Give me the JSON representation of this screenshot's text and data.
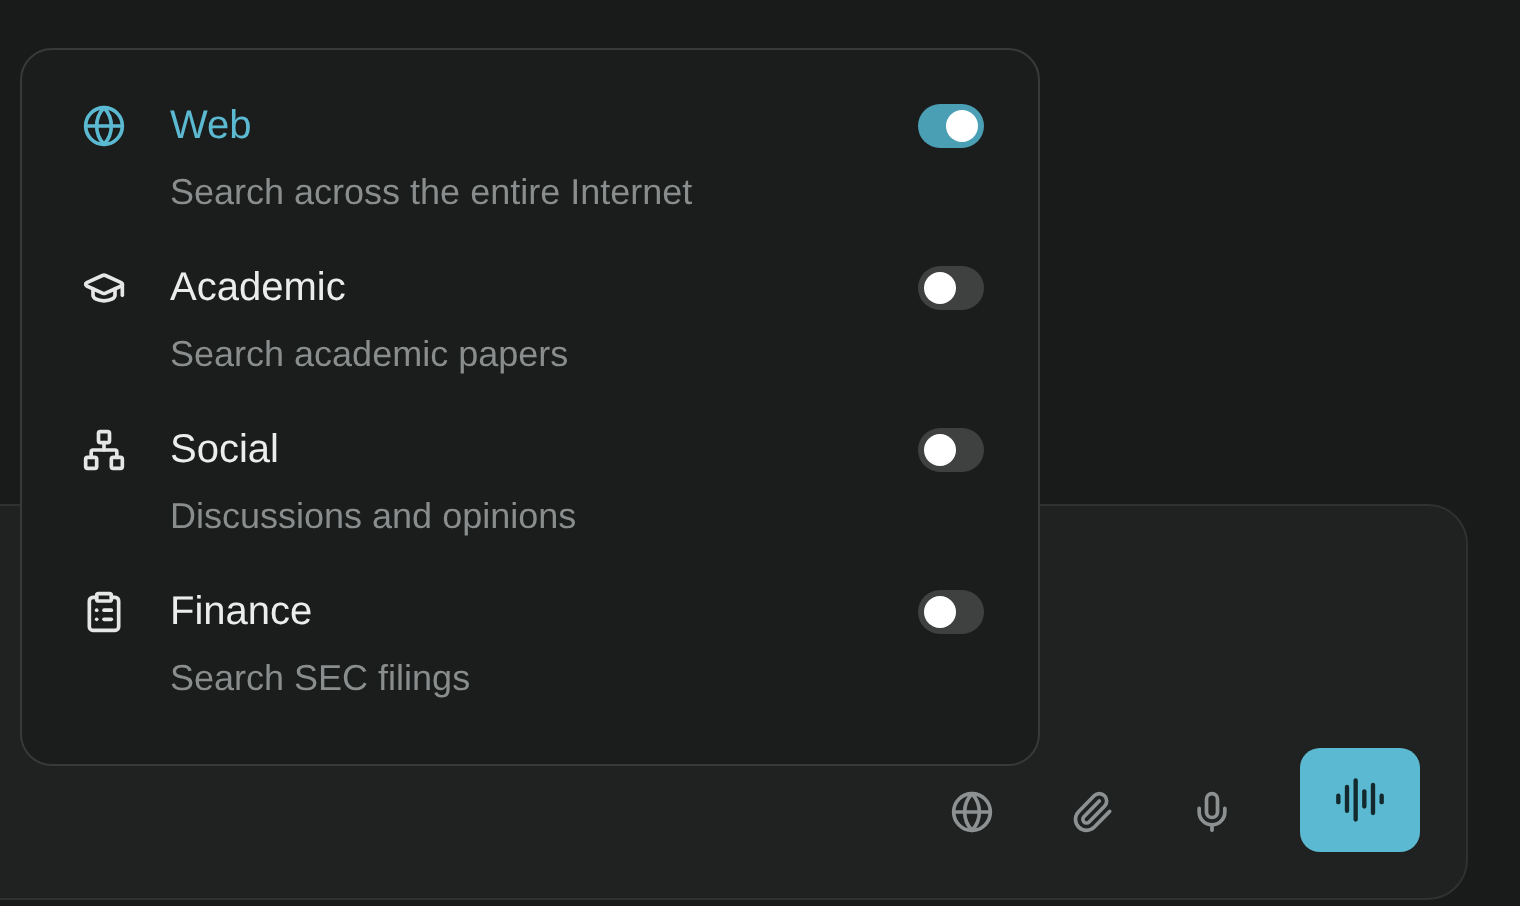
{
  "sources": [
    {
      "kind": "web",
      "title": "Web",
      "description": "Search across the entire Internet",
      "on": true
    },
    {
      "kind": "academic",
      "title": "Academic",
      "description": "Search academic papers",
      "on": false
    },
    {
      "kind": "social",
      "title": "Social",
      "description": "Discussions and opinions",
      "on": false
    },
    {
      "kind": "finance",
      "title": "Finance",
      "description": "Search SEC filings",
      "on": false
    }
  ]
}
